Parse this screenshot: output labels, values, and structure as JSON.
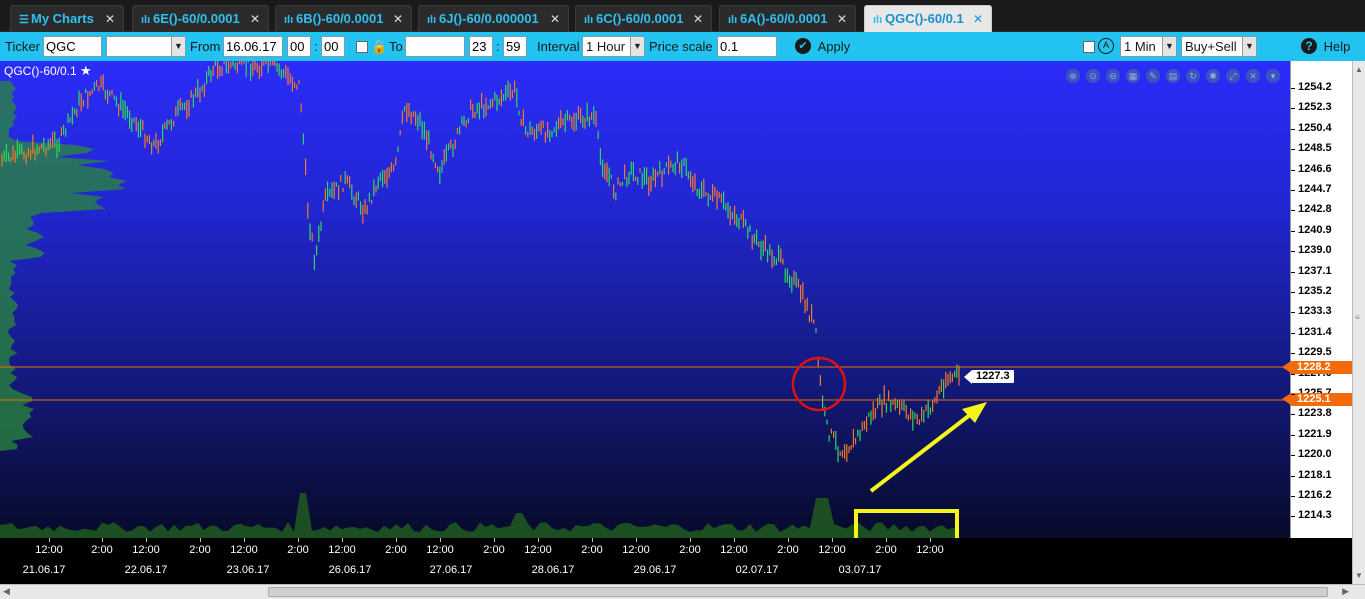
{
  "tabs": [
    {
      "label": "My Charts",
      "icon": "list-icon",
      "active": false
    },
    {
      "label": "6E()-60/0.0001",
      "icon": "bar-chart-icon",
      "active": false
    },
    {
      "label": "6B()-60/0.0001",
      "icon": "bar-chart-icon",
      "active": false
    },
    {
      "label": "6J()-60/0.000001",
      "icon": "bar-chart-icon",
      "active": false
    },
    {
      "label": "6C()-60/0.0001",
      "icon": "bar-chart-icon",
      "active": false
    },
    {
      "label": "6A()-60/0.0001",
      "icon": "bar-chart-icon",
      "active": false
    },
    {
      "label": "QGC()-60/0.1",
      "icon": "bar-chart-icon",
      "active": true
    }
  ],
  "toolbar": {
    "ticker_label": "Ticker",
    "ticker_value": "QGC",
    "ticker_select_value": "",
    "from_label": "From",
    "from_date": "16.06.17",
    "from_hour": "00",
    "from_minute": "00",
    "to_label": "To",
    "to_date": "",
    "to_hour": "23",
    "to_minute": "59",
    "interval_label": "Interval",
    "interval_value": "1 Hour",
    "price_scale_label": "Price scale",
    "price_scale_value": "0.1",
    "apply_label": "Apply",
    "update_interval_value": "1 Min",
    "mode_value": "Buy+Sell",
    "help_label": "Help"
  },
  "chart": {
    "title": "QGC()-60/0.1",
    "current_price": "1227.3",
    "levels": [
      "1228.2",
      "1225.1"
    ],
    "colors": {
      "level_line": "#f26a0a",
      "up_bar": "#2fd85a",
      "down_bar": "#f07a2a",
      "annotation_circle": "#e01010",
      "annotation_arrow": "#f5f51a",
      "annotation_box": "#f5f51a"
    }
  },
  "price_axis": {
    "labels": [
      "1254.2",
      "1252.3",
      "1250.4",
      "1248.5",
      "1246.6",
      "1244.7",
      "1242.8",
      "1240.9",
      "1239.0",
      "1237.1",
      "1235.2",
      "1233.3",
      "1231.4",
      "1229.5",
      "1227.6",
      "1225.7",
      "1223.8",
      "1221.9",
      "1220.0",
      "1218.1",
      "1216.2",
      "1214.3"
    ]
  },
  "time_axis": {
    "ticks": [
      "12:00",
      "2:00",
      "12:00",
      "2:00",
      "12:00",
      "2:00",
      "12:00",
      "2:00",
      "12:00",
      "2:00",
      "12:00",
      "2:00",
      "12:00",
      "2:00",
      "12:00",
      "2:00",
      "12:00",
      "2:00",
      "12:00"
    ],
    "dates": [
      "21.06.17",
      "22.06.17",
      "23.06.17",
      "26.06.17",
      "27.06.17",
      "28.06.17",
      "29.06.17",
      "02.07.17",
      "03.07.17"
    ]
  }
}
